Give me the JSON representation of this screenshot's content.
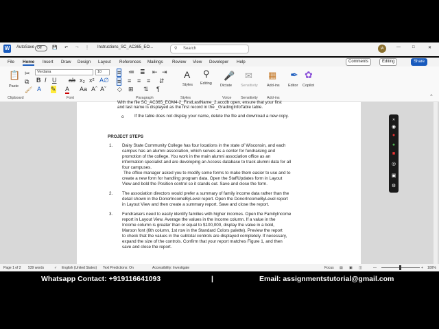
{
  "titlebar": {
    "autosave": "AutoSave",
    "toggle": "Off",
    "doc_name": "Instructions_SC_AC365_EO...",
    "search_placeholder": "Search",
    "user_initials": "IA"
  },
  "menu": {
    "items": [
      "File",
      "Home",
      "Insert",
      "Draw",
      "Design",
      "Layout",
      "References",
      "Mailings",
      "Review",
      "View",
      "Developer",
      "Help"
    ],
    "comments": "Comments",
    "editing": "Editing",
    "share": "Share"
  },
  "ribbon": {
    "font_name": "Verdana",
    "font_size": "10",
    "groups": {
      "clipboard": "Clipboard",
      "font": "Font",
      "paragraph": "Paragraph",
      "styles": "Styles",
      "voice": "Voice",
      "sensitivity": "Sensitivity",
      "addins": "Add-ins"
    },
    "buttons": {
      "paste": "Paste",
      "styles": "Styles",
      "editing": "Editing",
      "dictate": "Dictate",
      "sensitivity": "Sensitivity",
      "addins": "Add-ins",
      "editor": "Editor",
      "copilot": "Copilot"
    }
  },
  "document": {
    "top_line1": "With the file SC_AC365_EOM4-2_FirstLastName_2.accdb open, ensure that your first",
    "top_line2": "and last name is displayed as the first record in the _GradingInfoTable table.",
    "bullet": "If the table does not display your name, delete the file and download a new copy.",
    "heading": "PROJECT STEPS",
    "steps": [
      {
        "num": "1.",
        "lines": [
          "Dairy State Community College has four locations in the state of Wisconsin, and each",
          "campus has an alumni association, which serves as a center for fundraising and",
          "promotion of the college. You work in the main alumni association office as an",
          "information specialist and are developing an Access database to track alumni data for all",
          "four campuses.",
          "The office manager asked you to modify some forms to make them easier to use and to",
          "create a new form for handling program data. Open the StaffUpdates form in Layout",
          "View and bold the Position control so it stands out. Save and close the form."
        ]
      },
      {
        "num": "2.",
        "lines": [
          "The association directors would prefer a summary of family income data rather than the",
          "detail shown in the DonorIncomeByLevel report. Open the DonorIncomeByLevel report",
          "in Layout View and then create a summary report. Save and close the report."
        ]
      },
      {
        "num": "3.",
        "lines": [
          "Fundraisers need to easily identify families with higher incomes. Open the FamilyIncome",
          "report in Layout View. Average the values in the Income column. If a value in the",
          "Income column is greater than or equal to $100,000, display the value in a bold,",
          "Maroon font (6th column, 1st row in the Standard Colors palette). Preview the report",
          "to check that the values in the subtotal controls are displayed completely. If necessary,",
          "expand the size of the controls. Confirm that your report matches Figure 1, and then",
          "save and close the report."
        ]
      }
    ]
  },
  "status": {
    "page": "Page 1 of 2",
    "words": "539 words",
    "language": "English (United States)",
    "predictions": "Text Predictions: On",
    "accessibility": "Accessibility: Investigate",
    "focus": "Focus",
    "zoom": "100%"
  },
  "banner": {
    "whatsapp": "Whatsapp Contact: +919116641093",
    "separator": "|",
    "email": "Email: assignmentstutorial@gmail.com"
  }
}
